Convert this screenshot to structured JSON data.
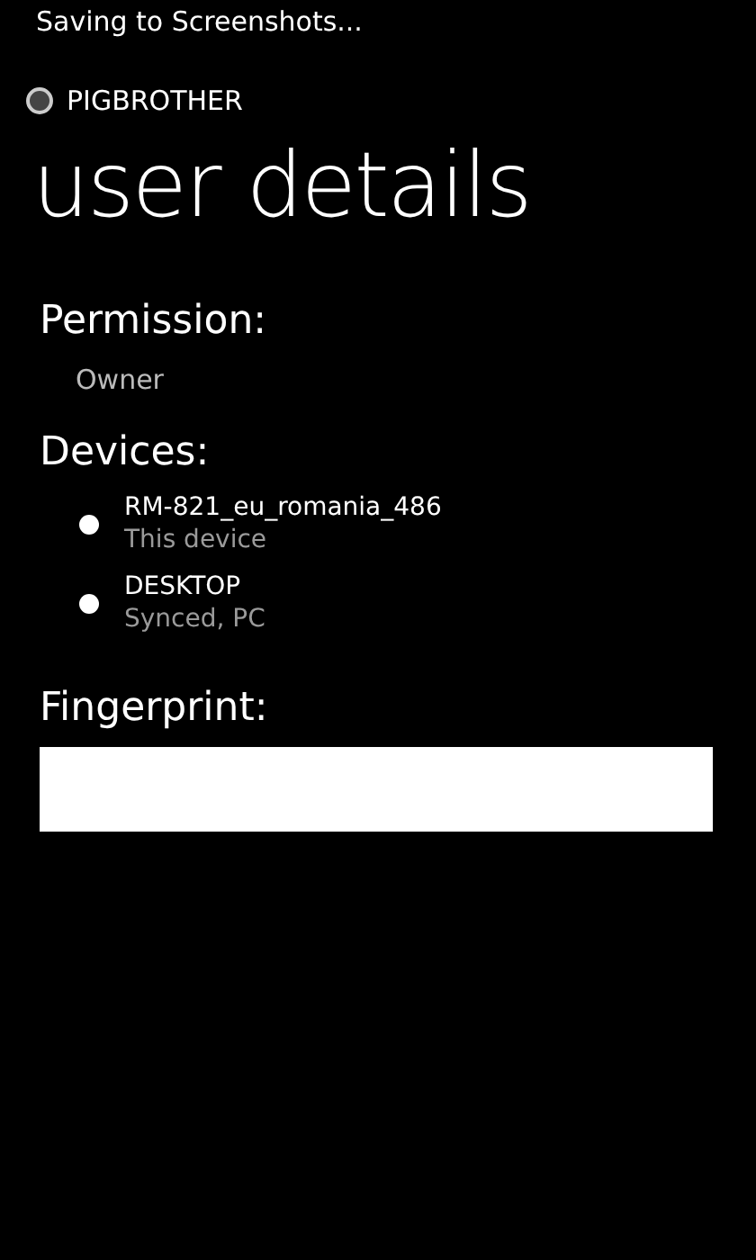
{
  "status_bar": {
    "notification": "Saving to Screenshots..."
  },
  "app_name": "PIGBROTHER",
  "title": "user details",
  "permission": {
    "label": "Permission:",
    "value": "Owner"
  },
  "devices": {
    "label": "Devices:",
    "items": [
      {
        "name": "RM-821_eu_romania_486",
        "detail": "This device"
      },
      {
        "name": "DESKTOP",
        "detail": "Synced, PC"
      }
    ]
  },
  "fingerprint": {
    "label": "Fingerprint:"
  }
}
